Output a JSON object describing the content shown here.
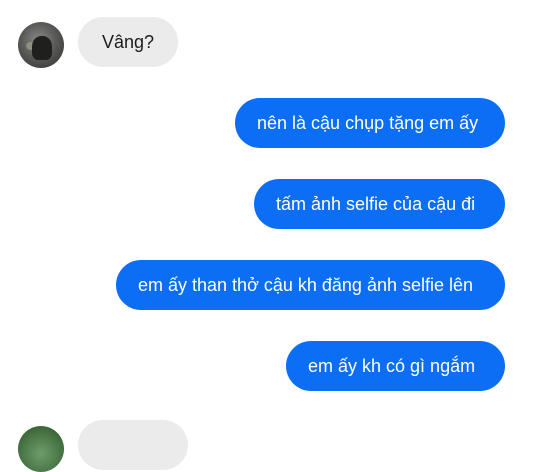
{
  "conversation": {
    "messages": [
      {
        "direction": "incoming",
        "text": "Vâng?"
      },
      {
        "direction": "outgoing",
        "text": "nên là cậu chụp tặng em ấy"
      },
      {
        "direction": "outgoing",
        "text": "tấm ảnh selfie của cậu đi"
      },
      {
        "direction": "outgoing",
        "text": "em ấy than thở cậu kh đăng ảnh selfie lên"
      },
      {
        "direction": "outgoing",
        "text": "em ấy kh có gì ngắm"
      },
      {
        "direction": "incoming",
        "text": ""
      }
    ]
  },
  "colors": {
    "outgoing_bubble": "#0b6ef5",
    "incoming_bubble": "#ebebeb",
    "background": "#ffffff"
  }
}
